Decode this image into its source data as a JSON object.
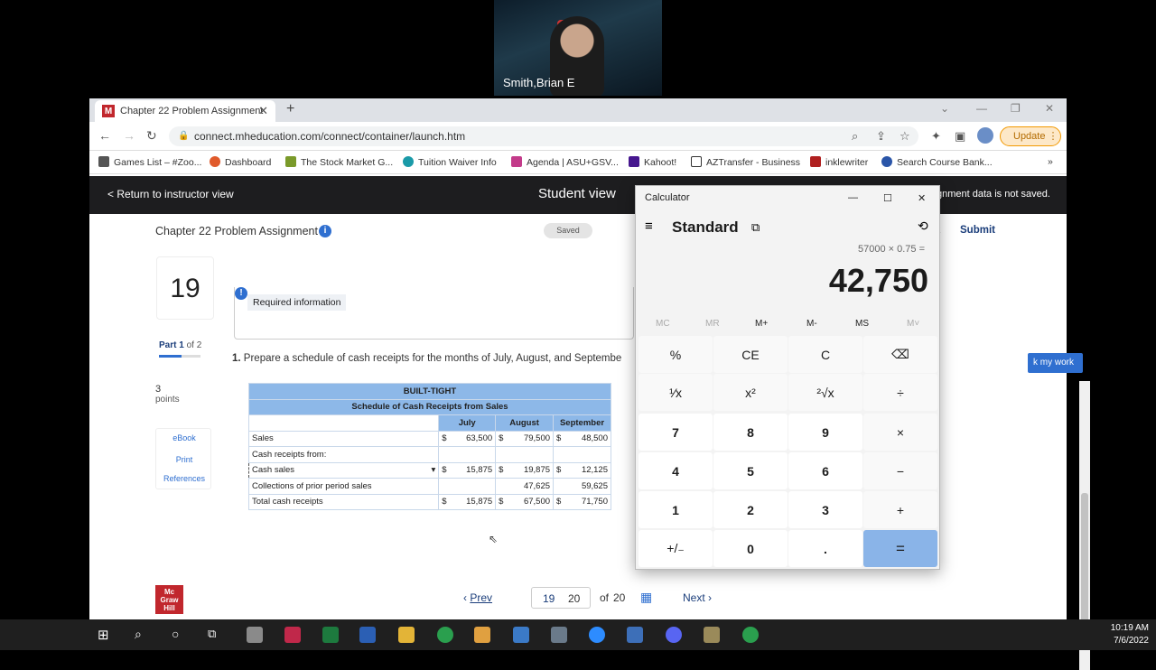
{
  "webcam": {
    "name": "Smith,Brian E"
  },
  "browser": {
    "tab_title": "Chapter 22 Problem Assignment",
    "tab_favicon": "M",
    "url": "connect.mheducation.com/connect/container/launch.htm",
    "update_label": "Update",
    "bookmarks": [
      "Games List – #Zoo...",
      "Dashboard",
      "The Stock Market G...",
      "Tuition Waiver Info",
      "Agenda | ASU+GSV...",
      "Kahoot!",
      "AZTransfer - Business",
      "inklewriter",
      "Search Course Bank..."
    ],
    "bookmarks_more": "»"
  },
  "page": {
    "return_label": "< Return to instructor view",
    "student_view": "Student view",
    "not_saved": "gnment data is not saved.",
    "assignment_title": "Chapter 22 Problem Assignment",
    "saved": "Saved",
    "exit": "t",
    "submit": "Submit",
    "check_work": "k my work",
    "question_number": "19",
    "part_label": "Part 1",
    "part_of": "of 2",
    "points_value": "3",
    "points_label": "points",
    "links": [
      "eBook",
      "Print",
      "References"
    ],
    "required_info": "Required information",
    "question_num": "1.",
    "question_text": "Prepare a schedule of cash receipts for the months of July, August, and Septembe",
    "pager": {
      "prev": "Prev",
      "current": "19",
      "alt": "20",
      "of": "of",
      "total": "20",
      "next": "Next"
    },
    "logo_text": [
      "Mc",
      "Graw",
      "Hill"
    ]
  },
  "schedule": {
    "company": "BUILT-TIGHT",
    "title": "Schedule of Cash Receipts from Sales",
    "columns": [
      "July",
      "August",
      "September"
    ],
    "rows": [
      {
        "label": "Sales",
        "dollar": true,
        "values": [
          "63,500",
          "79,500",
          "48,500"
        ]
      },
      {
        "label": "Cash receipts from:",
        "dollar": false,
        "values": [
          "",
          "",
          ""
        ]
      },
      {
        "label": "Cash sales",
        "dollar": true,
        "values": [
          "15,875",
          "19,875",
          "12,125"
        ]
      },
      {
        "label": "Collections of prior period sales",
        "dollar": false,
        "values": [
          "",
          "47,625",
          "59,625"
        ]
      },
      {
        "label": "Total cash receipts",
        "dollar": true,
        "values": [
          "15,875",
          "67,500",
          "71,750"
        ]
      }
    ],
    "dollar_sign": "$"
  },
  "calculator": {
    "title": "Calculator",
    "mode": "Standard",
    "expression": "57000 × 0.75 =",
    "display": "42,750",
    "memory": [
      "MC",
      "MR",
      "M+",
      "M-",
      "MS",
      "M˅"
    ],
    "keys": [
      [
        "%",
        "CE",
        "C",
        "⌫"
      ],
      [
        "¹⁄x",
        "x²",
        "²√x",
        "÷"
      ],
      [
        "7",
        "8",
        "9",
        "×"
      ],
      [
        "4",
        "5",
        "6",
        "−"
      ],
      [
        "1",
        "2",
        "3",
        "+"
      ],
      [
        "+/₋",
        "0",
        ".",
        "="
      ]
    ]
  },
  "taskbar": {
    "time": "10:19 AM",
    "date": "7/6/2022"
  }
}
